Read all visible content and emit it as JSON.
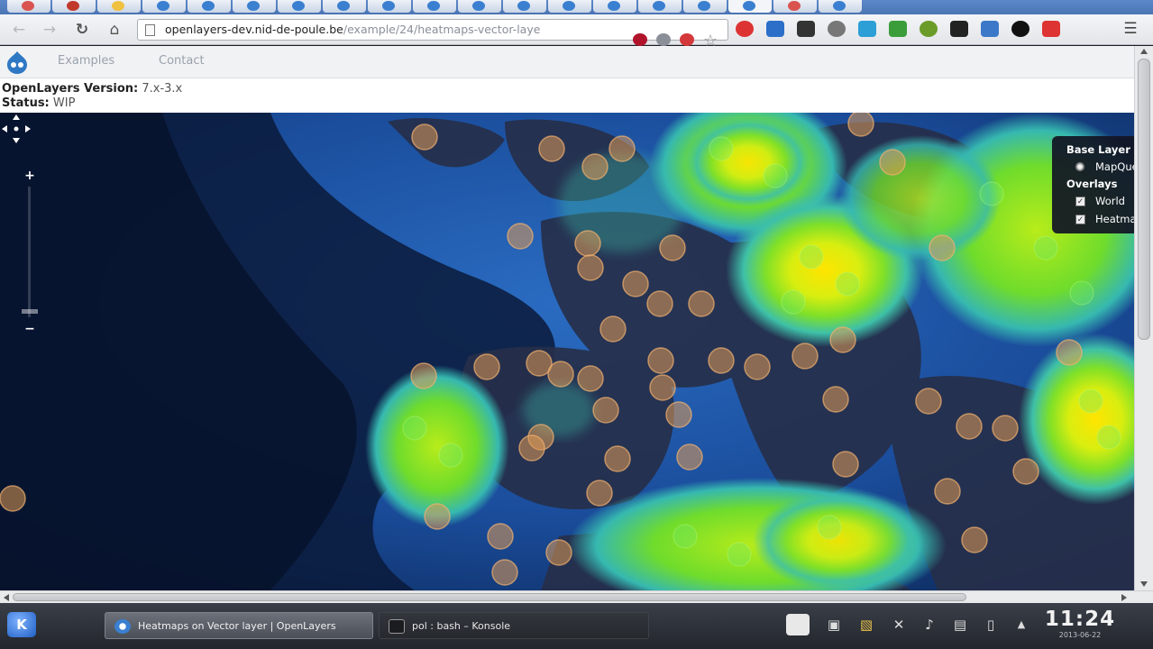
{
  "browser": {
    "tab_count": 19,
    "address": {
      "host": "openlayers-dev.nid-de-poule.be",
      "path": "/example/24/heatmaps-vector-laye"
    },
    "colors": {
      "tabstrip": "#4a74b4",
      "toolbar": "#e9ebee"
    }
  },
  "site": {
    "nav": {
      "examples": "Examples",
      "contact": "Contact"
    },
    "version_label": "OpenLayers Version:",
    "version_value": "7.x-3.x",
    "status_label": "Status:",
    "status_value": "WIP"
  },
  "map": {
    "controls": {
      "zoom_in": "+",
      "zoom_out": "−"
    },
    "layer_switcher": {
      "base_header": "Base Layer",
      "base_item": "MapQuest",
      "overlays_header": "Overlays",
      "overlay_items": [
        "World",
        "Heatmap"
      ]
    },
    "icons": [
      "pan-icon",
      "zoom-in-icon",
      "zoom-out-icon"
    ]
  },
  "taskbar": {
    "launcher": "K",
    "tasks": {
      "browser": "Heatmaps on Vector layer | OpenLayers",
      "konsole": "pol : bash – Konsole"
    },
    "clock": {
      "time": "11:24",
      "date": "2013-06-22"
    }
  }
}
